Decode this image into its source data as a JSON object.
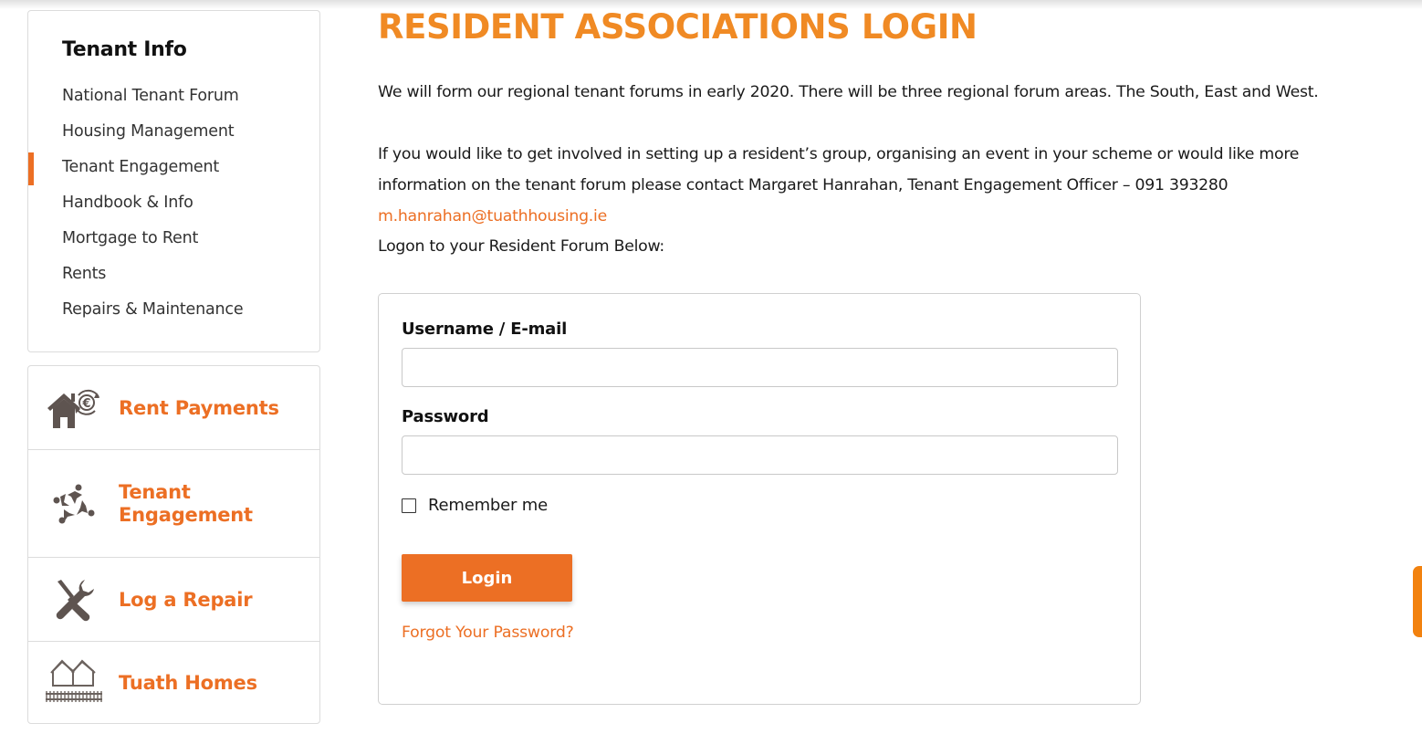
{
  "sidebar": {
    "title": "Tenant Info",
    "items": [
      {
        "label": "National Tenant Forum",
        "active": false
      },
      {
        "label": "Housing Management",
        "active": false
      },
      {
        "label": "Tenant Engagement",
        "active": true
      },
      {
        "label": "Handbook & Info",
        "active": false
      },
      {
        "label": "Mortgage to Rent",
        "active": false
      },
      {
        "label": "Rents",
        "active": false
      },
      {
        "label": "Repairs & Maintenance",
        "active": false
      }
    ]
  },
  "quick_links": [
    {
      "label": "Rent Payments",
      "icon": "house-euro-icon"
    },
    {
      "label_line1": "Tenant",
      "label_line2": "Engagement",
      "icon": "people-group-icon"
    },
    {
      "label": "Log a Repair",
      "icon": "wrench-screwdriver-icon"
    },
    {
      "label": "Tuath Homes",
      "icon": "houses-fence-icon"
    }
  ],
  "main": {
    "title": "RESIDENT ASSOCIATIONS LOGIN",
    "intro": "We will form our regional tenant forums in early 2020. There will be three regional forum areas. The South, East and West.",
    "contact_text": "If you would like to get involved in setting up a resident’s group, organising an event in your scheme or would like more information on the tenant forum please contact Margaret Hanrahan, Tenant Engagement Officer – 091 393280 ",
    "contact_email": "m.hanrahan@tuathhousing.ie",
    "logon_prompt": "Logon to your Resident Forum Below:"
  },
  "login_form": {
    "username_label": "Username / E-mail",
    "username_value": "",
    "password_label": "Password",
    "password_value": "",
    "remember_label": "Remember me",
    "remember_checked": false,
    "login_button": "Login",
    "forgot_link": "Forgot Your Password?"
  },
  "colors": {
    "accent": "#ec6f24",
    "title": "#f08a24",
    "icon": "#5e5450"
  }
}
